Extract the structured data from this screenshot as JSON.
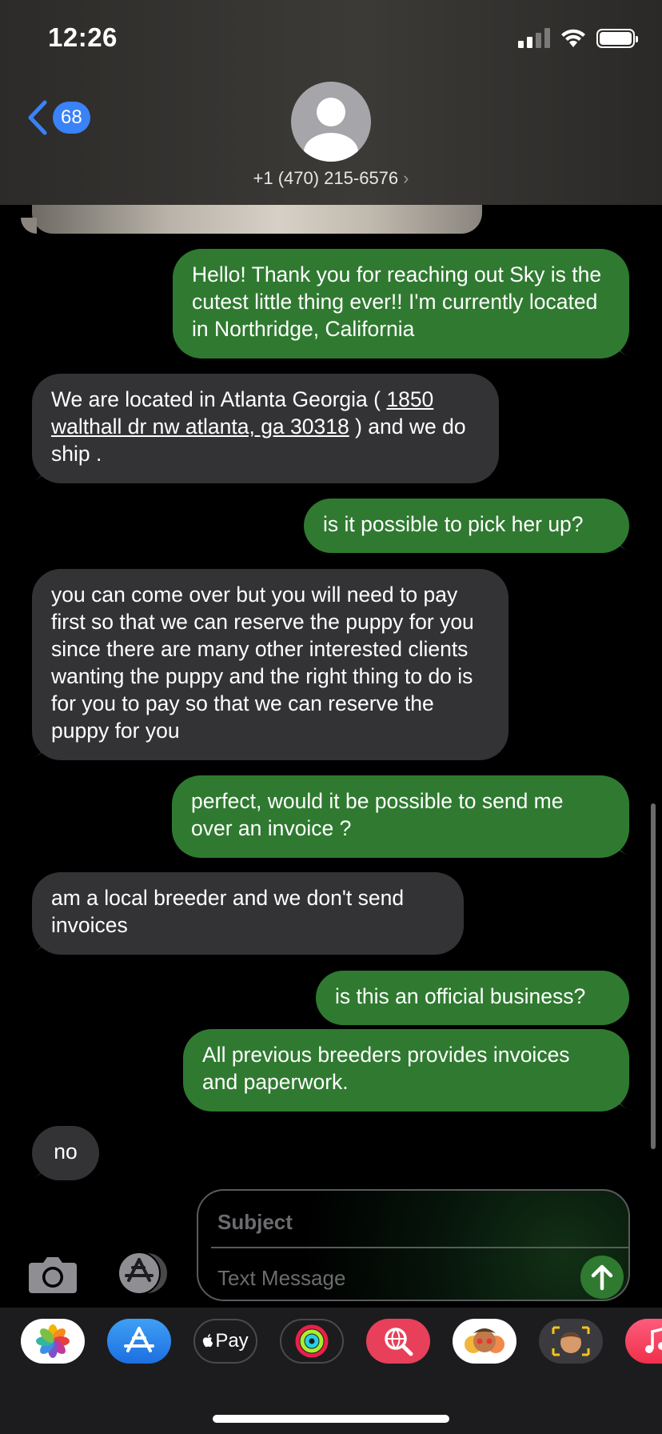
{
  "status": {
    "time": "12:26"
  },
  "header": {
    "back_count": "68",
    "contact": "+1 (470) 215-6576",
    "contact_chevron": "›"
  },
  "messages": [
    {
      "dir": "sent",
      "text": "Hello! Thank you for reaching out Sky is the cutest little thing ever!! I'm currently located in Northridge, California"
    },
    {
      "dir": "recv",
      "text_before": "We are located in Atlanta Georgia  ( ",
      "link": "1850 walthall dr nw atlanta, ga 30318",
      "text_after": " ) and we do ship ."
    },
    {
      "dir": "sent",
      "text": "is it possible to pick her up?"
    },
    {
      "dir": "recv",
      "text": "you can come over but you will need to pay first so that we can reserve the puppy for you since there are many other interested clients wanting the puppy and the right thing to do is for you to pay so that we can reserve the puppy for you"
    },
    {
      "dir": "sent",
      "text": "perfect, would it be possible to send me over an invoice ?"
    },
    {
      "dir": "recv",
      "text": "am a local breeder and we don't send invoices"
    },
    {
      "dir": "sent",
      "text": "is this an official business?"
    },
    {
      "dir": "sent",
      "text": "All previous breeders provides invoices and paperwork."
    },
    {
      "dir": "recv",
      "text": "no"
    }
  ],
  "composer": {
    "subject_placeholder": "Subject",
    "message_placeholder": "Text Message"
  },
  "drawer": {
    "apps": [
      {
        "name": "photos-app-icon"
      },
      {
        "name": "app-store-app-icon"
      },
      {
        "name": "apple-pay-app-icon",
        "label": "Pay"
      },
      {
        "name": "fitness-app-icon"
      },
      {
        "name": "image-search-app-icon"
      },
      {
        "name": "memoji-stickers-app-icon"
      },
      {
        "name": "animoji-app-icon"
      },
      {
        "name": "music-app-icon"
      }
    ]
  },
  "colors": {
    "sent_bubble": "#2f7a30",
    "recv_bubble": "#333336",
    "accent": "#3a82f7"
  }
}
